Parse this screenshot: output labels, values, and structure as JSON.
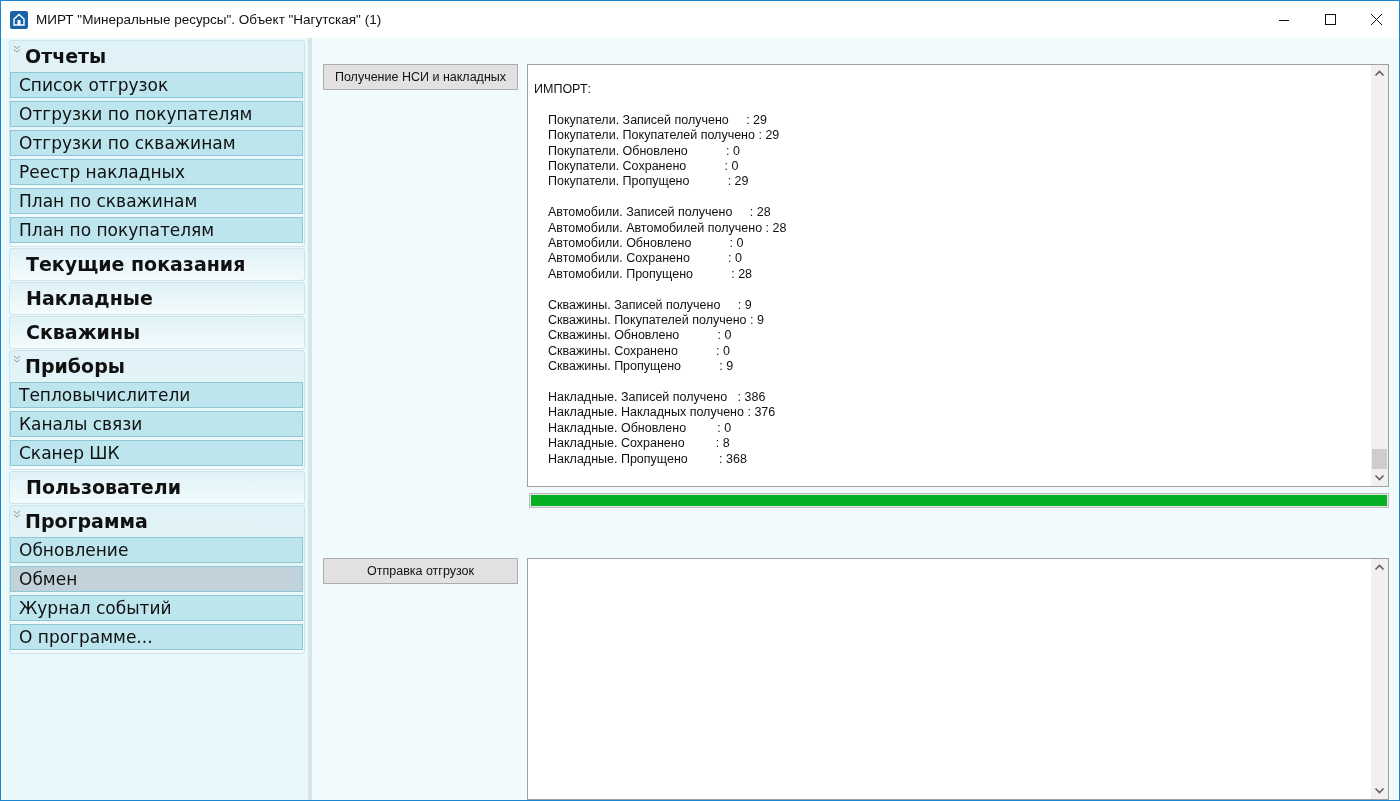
{
  "window": {
    "title": "МИРТ \"Минеральные ресурсы\". Объект \"Нагутская\" (1)"
  },
  "sidebar": {
    "groups": [
      {
        "title": "Отчеты",
        "expanded": true,
        "items": [
          {
            "label": "Список отгрузок",
            "selected": false
          },
          {
            "label": "Отгрузки по покупателям",
            "selected": false
          },
          {
            "label": "Отгрузки по скважинам",
            "selected": false
          },
          {
            "label": "Реестр накладных",
            "selected": false
          },
          {
            "label": "План по скважинам",
            "selected": false
          },
          {
            "label": "План по покупателям",
            "selected": false
          }
        ]
      },
      {
        "title": "Текущие показания",
        "expanded": false
      },
      {
        "title": "Накладные",
        "expanded": false
      },
      {
        "title": "Скважины",
        "expanded": false
      },
      {
        "title": "Приборы",
        "expanded": true,
        "items": [
          {
            "label": "Тепловычислители",
            "selected": false
          },
          {
            "label": "Каналы связи",
            "selected": false
          },
          {
            "label": "Сканер ШК",
            "selected": false
          }
        ]
      },
      {
        "title": "Пользователи",
        "expanded": false
      },
      {
        "title": "Программа",
        "expanded": true,
        "items": [
          {
            "label": "Обновление",
            "selected": false
          },
          {
            "label": "Обмен",
            "selected": true
          },
          {
            "label": "Журнал событий",
            "selected": false
          },
          {
            "label": "О программе...",
            "selected": false
          }
        ]
      }
    ]
  },
  "import": {
    "button": "Получение НСИ и накладных",
    "heading": "ИМПОРТ:",
    "blocks": [
      [
        "Покупатели. Записей получено     : 29",
        "Покупатели. Покупателей получено : 29",
        "Покупатели. Обновлено           : 0",
        "Покупатели. Сохранено           : 0",
        "Покупатели. Пропущено           : 29"
      ],
      [
        "Автомобили. Записей получено     : 28",
        "Автомобили. Автомобилей получено : 28",
        "Автомобили. Обновлено           : 0",
        "Автомобили. Сохранено           : 0",
        "Автомобили. Пропущено           : 28"
      ],
      [
        "Скважины. Записей получено     : 9",
        "Скважины. Покупателей получено : 9",
        "Скважины. Обновлено           : 0",
        "Скважины. Сохранено           : 0",
        "Скважины. Пропущено           : 9"
      ],
      [
        "Накладные. Записей получено   : 386",
        "Накладные. Накладных получено : 376",
        "Накладные. Обновлено         : 0",
        "Накладные. Сохранено         : 8",
        "Накладные. Пропущено         : 368"
      ]
    ],
    "progress": {
      "level": 1
    }
  },
  "export": {
    "button": "Отправка отгрузок"
  }
}
